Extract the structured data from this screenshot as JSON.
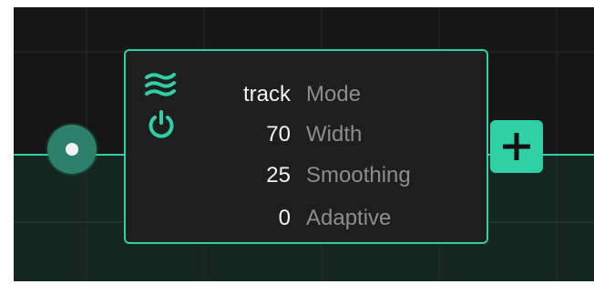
{
  "node": {
    "params": [
      {
        "value": "track",
        "label": "Mode"
      },
      {
        "value": "70",
        "label": "Width"
      },
      {
        "value": "25",
        "label": "Smoothing"
      },
      {
        "value": "0",
        "label": "Adaptive"
      }
    ],
    "icons": {
      "type": "wave-icon",
      "power": "power-icon"
    }
  },
  "controls": {
    "add_icon": "plus-icon",
    "handle_icon": "connection-handle"
  },
  "colors": {
    "accent": "#2fd0a6",
    "background": "#161616",
    "card": "#1e1e1e",
    "value_text": "#f2f2f2",
    "label_text": "#8d8d8d"
  }
}
